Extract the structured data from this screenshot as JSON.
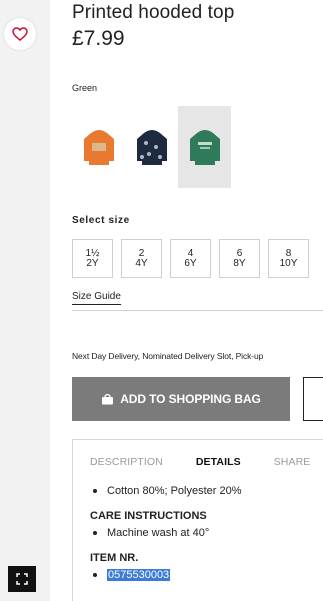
{
  "product": {
    "title": "Printed hooded top",
    "price": "£7.99",
    "selected_color": "Green"
  },
  "swatches": [
    {
      "name": "orange",
      "color": "#e8792e",
      "accent": "#d9c7a0"
    },
    {
      "name": "navy",
      "color": "#1d2a3f",
      "accent": "#aab8c8"
    },
    {
      "name": "green",
      "color": "#2e7a5a",
      "accent": "#d7e5dc",
      "selected": true
    }
  ],
  "size": {
    "label": "Select size",
    "options": [
      {
        "top": "1½",
        "bottom": "2Y"
      },
      {
        "top": "2",
        "bottom": "4Y"
      },
      {
        "top": "4",
        "bottom": "6Y"
      },
      {
        "top": "6",
        "bottom": "8Y"
      },
      {
        "top": "8",
        "bottom": "10Y"
      }
    ],
    "guide_label": "Size Guide"
  },
  "delivery_text": "Next Day Delivery, Nominated Delivery Slot, Pick-up",
  "actions": {
    "add_to_bag": "ADD TO SHOPPING BAG"
  },
  "tabs": [
    "DESCRIPTION",
    "DETAILS",
    "SHARE"
  ],
  "details": {
    "composition": "Cotton 80%; Polyester 20%",
    "care_heading": "CARE INSTRUCTIONS",
    "care_item": "Machine wash at 40°",
    "item_heading": "ITEM NR.",
    "item_number": "0575530003"
  },
  "icons": {
    "favorite": "heart-icon",
    "expand": "expand-icon",
    "bag": "bag-icon"
  },
  "colors": {
    "accent_heart": "#c8102e",
    "button_bg": "#7b7b7b",
    "selection": "#3e7bd6"
  }
}
